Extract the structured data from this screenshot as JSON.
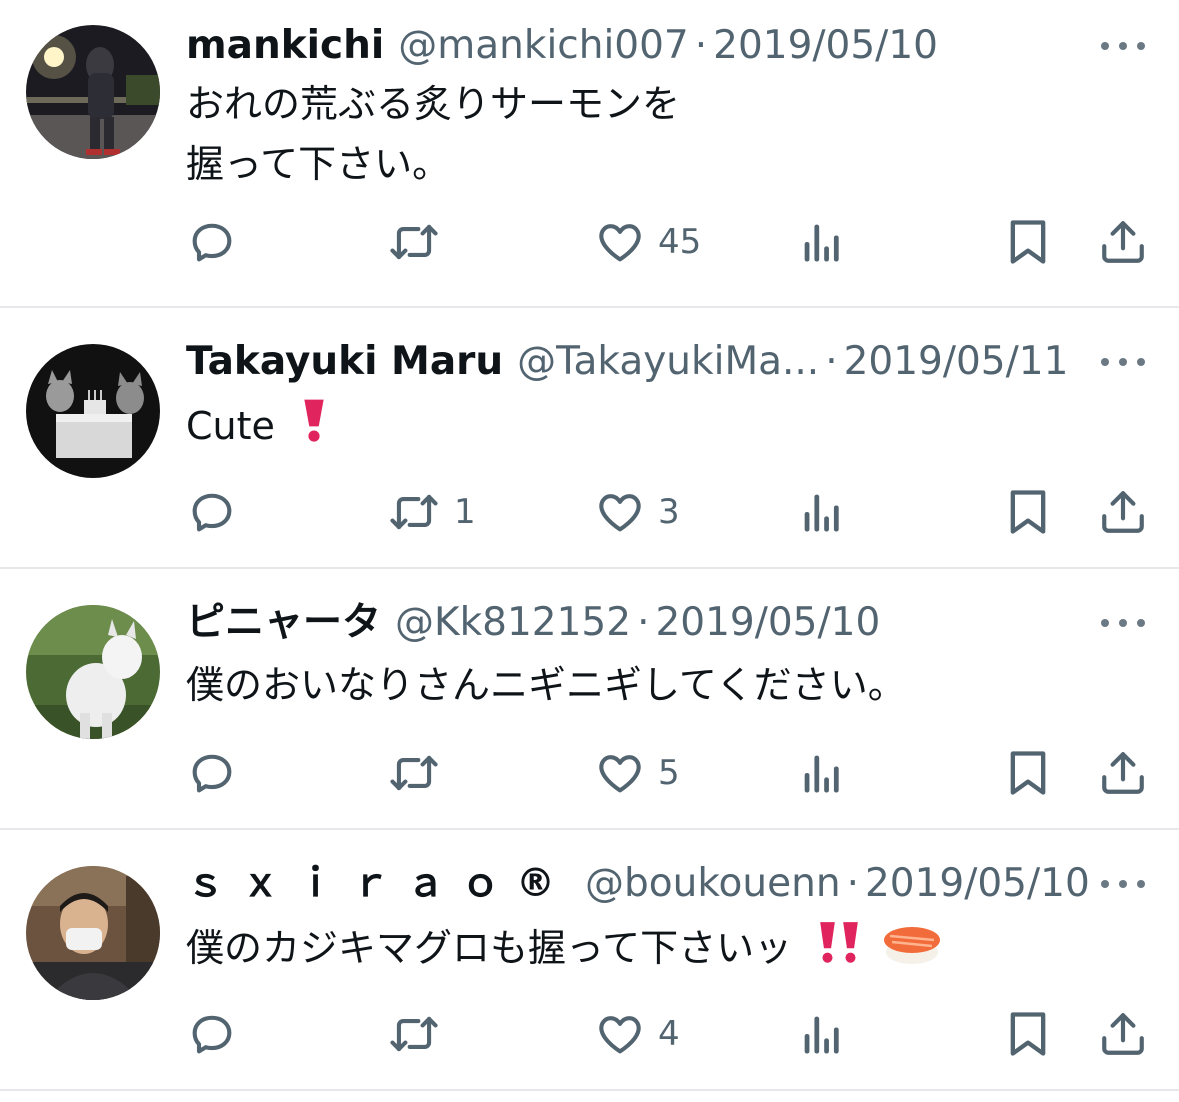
{
  "colors": {
    "text": "#0f1419",
    "muted": "#536471",
    "divider": "#e5e7ea",
    "heart": "#e0245e"
  },
  "icons": {
    "reply": "speech-bubble-icon",
    "retweet": "retweet-icon",
    "like": "heart-icon",
    "views": "bar-chart-icon",
    "bookmark": "bookmark-icon",
    "share": "share-upload-icon",
    "more": "more-dots-icon"
  },
  "tweets": [
    {
      "name": "mankichi",
      "handle": "@mankichi007",
      "dot": "·",
      "date": "2019/05/10",
      "text_lines": [
        "おれの荒ぶる炙りサーモンを",
        "握って下さい。"
      ],
      "emoji": "",
      "reply_count": "",
      "retweet_count": "",
      "like_count": "45"
    },
    {
      "name": "Takayuki Maru",
      "handle": "@TakayukiMa...",
      "dot": "·",
      "date": "2019/05/11",
      "text_lines": [
        "Cute"
      ],
      "emoji": "heavy-exclamation-mark",
      "reply_count": "",
      "retweet_count": "1",
      "like_count": "3"
    },
    {
      "name": "ピニャータ",
      "handle": "@Kk812152",
      "dot": "·",
      "date": "2019/05/10",
      "text_lines": [
        "僕のおいなりさんニギニギしてください。"
      ],
      "emoji": "",
      "reply_count": "",
      "retweet_count": "",
      "like_count": "5"
    },
    {
      "name": "ｓｘｉｒａｏ®",
      "handle": "@boukouenn",
      "dot": "·",
      "date": "2019/05/10",
      "text_lines": [
        "僕のカジキマグロも握って下さいッ"
      ],
      "emoji": "double-exclamation-and-sushi",
      "reply_count": "",
      "retweet_count": "",
      "like_count": "4"
    }
  ]
}
